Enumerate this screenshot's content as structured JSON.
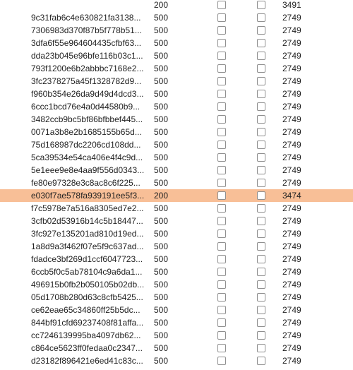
{
  "rows": [
    {
      "id": "",
      "status": "200",
      "length": "3491",
      "selected": false,
      "flag1": false,
      "flag2": false
    },
    {
      "id": "9c31fab6c4e630821fa3138...",
      "status": "500",
      "length": "2749",
      "selected": false,
      "flag1": false,
      "flag2": false
    },
    {
      "id": "7306983d370f87b5f778b51...",
      "status": "500",
      "length": "2749",
      "selected": false,
      "flag1": false,
      "flag2": false
    },
    {
      "id": "3dfa6f55e964604435cfbf63...",
      "status": "500",
      "length": "2749",
      "selected": false,
      "flag1": false,
      "flag2": false
    },
    {
      "id": "dda23b045e96bfe116b03c1...",
      "status": "500",
      "length": "2749",
      "selected": false,
      "flag1": false,
      "flag2": false
    },
    {
      "id": "793f1200e6b2abbbc7168e2...",
      "status": "500",
      "length": "2749",
      "selected": false,
      "flag1": false,
      "flag2": false
    },
    {
      "id": "3fc2378275a45f1328782d9...",
      "status": "500",
      "length": "2749",
      "selected": false,
      "flag1": false,
      "flag2": false
    },
    {
      "id": "f960b354e26da9d49d4dcd3...",
      "status": "500",
      "length": "2749",
      "selected": false,
      "flag1": false,
      "flag2": false
    },
    {
      "id": "6ccc1bcd76e4a0d44580b9...",
      "status": "500",
      "length": "2749",
      "selected": false,
      "flag1": false,
      "flag2": false
    },
    {
      "id": "3482ccb9bc5bf86bfbbef445...",
      "status": "500",
      "length": "2749",
      "selected": false,
      "flag1": false,
      "flag2": false
    },
    {
      "id": "0071a3b8e2b1685155b65d...",
      "status": "500",
      "length": "2749",
      "selected": false,
      "flag1": false,
      "flag2": false
    },
    {
      "id": "75d168987dc2206cd108dd...",
      "status": "500",
      "length": "2749",
      "selected": false,
      "flag1": false,
      "flag2": false
    },
    {
      "id": "5ca39534e54ca406e4f4c9d...",
      "status": "500",
      "length": "2749",
      "selected": false,
      "flag1": false,
      "flag2": false
    },
    {
      "id": "5e1eee9e8e4aa9f556d0343...",
      "status": "500",
      "length": "2749",
      "selected": false,
      "flag1": false,
      "flag2": false
    },
    {
      "id": "fe80e97328e3c8ac8c6f225...",
      "status": "500",
      "length": "2749",
      "selected": false,
      "flag1": false,
      "flag2": false
    },
    {
      "id": "e030f7ae578fa939191ee5f3...",
      "status": "200",
      "length": "3474",
      "selected": true,
      "flag1": false,
      "flag2": false
    },
    {
      "id": "f7c5978e7a516a8305ed7e2...",
      "status": "500",
      "length": "2749",
      "selected": false,
      "flag1": false,
      "flag2": false
    },
    {
      "id": "3cfb02d53916b14c5b18447...",
      "status": "500",
      "length": "2749",
      "selected": false,
      "flag1": false,
      "flag2": false
    },
    {
      "id": "3fc927e135201ad810d19ed...",
      "status": "500",
      "length": "2749",
      "selected": false,
      "flag1": false,
      "flag2": false
    },
    {
      "id": "1a8d9a3f462f07e5f9c637ad...",
      "status": "500",
      "length": "2749",
      "selected": false,
      "flag1": false,
      "flag2": false
    },
    {
      "id": "fdadce3bf269d1ccf6047723...",
      "status": "500",
      "length": "2749",
      "selected": false,
      "flag1": false,
      "flag2": false
    },
    {
      "id": "6ccb5f0c5ab78104c9a6da1...",
      "status": "500",
      "length": "2749",
      "selected": false,
      "flag1": false,
      "flag2": false
    },
    {
      "id": "496915b0fb2b050105b02db...",
      "status": "500",
      "length": "2749",
      "selected": false,
      "flag1": false,
      "flag2": false
    },
    {
      "id": "05d1708b280d63c8cfb5425...",
      "status": "500",
      "length": "2749",
      "selected": false,
      "flag1": false,
      "flag2": false
    },
    {
      "id": "ce62eae65c34860ff25b5dc...",
      "status": "500",
      "length": "2749",
      "selected": false,
      "flag1": false,
      "flag2": false
    },
    {
      "id": "844bf91cfd69237408f81affa...",
      "status": "500",
      "length": "2749",
      "selected": false,
      "flag1": false,
      "flag2": false
    },
    {
      "id": "cc7246139995ba4097db62...",
      "status": "500",
      "length": "2749",
      "selected": false,
      "flag1": false,
      "flag2": false
    },
    {
      "id": "c864ce5623ff0fedaa0c2347...",
      "status": "500",
      "length": "2749",
      "selected": false,
      "flag1": false,
      "flag2": false
    },
    {
      "id": "d23182f896421e6ed41c83c...",
      "status": "500",
      "length": "2749",
      "selected": false,
      "flag1": false,
      "flag2": false
    }
  ],
  "colors": {
    "selected_row": "#f8bf97",
    "background": "#ffffff",
    "text": "#222222"
  }
}
